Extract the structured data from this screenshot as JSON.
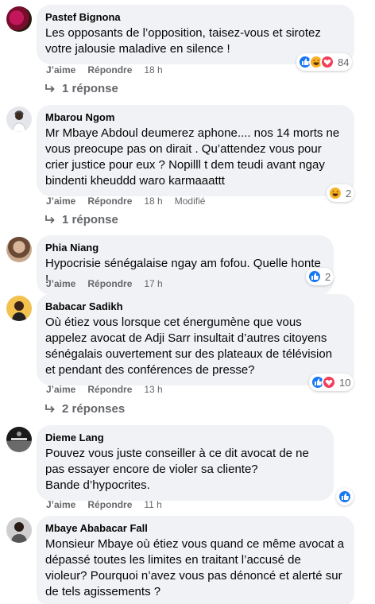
{
  "comments": [
    {
      "author": "Pastef Bignona",
      "text": "Les opposants de l’opposition, taisez-vous et sirotez votre jalousie maladive en silence !",
      "like": "J’aime",
      "reply": "Répondre",
      "time": "18 h",
      "edited": "",
      "reaction_count": "84",
      "reaction_icons": [
        "like-icon",
        "haha-icon",
        "love-icon"
      ],
      "replies": "1 réponse"
    },
    {
      "author": "Mbarou Ngom",
      "text": "Mr Mbaye Abdoul deumerez aphone.... nos 14 morts ne vous preocupe pas on dirait . Qu’attendez vous pour crier justice pour eux ? Nopilll t dem teudi avant ngay bindenti kheuddd waro karmaaattt",
      "like": "J’aime",
      "reply": "Répondre",
      "time": "18 h",
      "edited": "Modifié",
      "reaction_count": "2",
      "reaction_icons": [
        "haha-icon"
      ],
      "replies": "1 réponse"
    },
    {
      "author": "Phia Niang",
      "text": "Hypocrisie sénégalaise ngay am fofou. Quelle honte !",
      "like": "J’aime",
      "reply": "Répondre",
      "time": "17 h",
      "edited": "",
      "reaction_count": "2",
      "reaction_icons": [
        "like-icon"
      ],
      "replies": ""
    },
    {
      "author": "Babacar Sadikh",
      "text": "Où étiez vous lorsque cet énergumène que vous appelez avocat de Adji Sarr insultait d’autres citoyens sénégalais ouvertement sur des plateaux de télévision et pendant des conférences de presse?",
      "like": "J’aime",
      "reply": "Répondre",
      "time": "13 h",
      "edited": "",
      "reaction_count": "10",
      "reaction_icons": [
        "like-icon",
        "love-icon"
      ],
      "replies": "2 réponses"
    },
    {
      "author": "Dieme Lang",
      "text": "Pouvez vous juste conseiller à ce dit avocat de ne pas essayer encore de violer sa cliente?\nBande d’hypocrites.",
      "like": "J’aime",
      "reply": "Répondre",
      "time": "11 h",
      "edited": "",
      "reaction_count": "",
      "reaction_icons": [
        "like-icon"
      ],
      "replies": ""
    },
    {
      "author": "Mbaye Ababacar Fall",
      "text": "Monsieur Mbaye où étiez vous quand ce même avocat a dépassé toutes les limites en traitant l’accusé de violeur? Pourquoi n’avez vous pas dénoncé et alerté sur de tels agissements ?",
      "like": "",
      "reply": "",
      "time": "",
      "edited": "",
      "reaction_count": "",
      "reaction_icons": [],
      "replies": ""
    }
  ],
  "colors": {
    "bubble": "#f0f2f5",
    "secondary_text": "#65676b",
    "like_blue": "#1877f2",
    "haha_yellow": "#f7b125",
    "love_red": "#f33e58"
  }
}
